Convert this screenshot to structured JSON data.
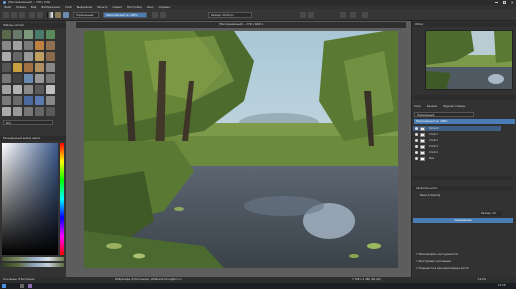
{
  "window": {
    "title": "[Несохранённый] — СНС | Krita"
  },
  "menu": [
    "Файл",
    "Правка",
    "Вид",
    "Изображение",
    "Слой",
    "Выделение",
    "Фильтр",
    "Сервис",
    "Настройка",
    "Окно",
    "Справка"
  ],
  "toolbar": {
    "blend_mode": "Нормальный",
    "opacity_label": "Непрозрачность: 100%",
    "size_label": "Размер: 20.00 px"
  },
  "left_dock": {
    "brushes_title": "Наборы кистей",
    "color_title": "Расширенный выбор цвета",
    "tag_label": "Всё"
  },
  "document_tab": "[Несохранённый] — СНС | RAW 1",
  "right_dock": {
    "overview_title": "Обзор",
    "tabs": [
      "Слои",
      "Каналы",
      "Журнал отмены"
    ],
    "layer_mode": "Нормальный",
    "layer_opacity": "Непрозрачность: 100%",
    "layers": [
      "Фильтр",
      "Слой 1",
      "Слой 2",
      "Слой 3",
      "Слой 4",
      "Фон"
    ],
    "brush_props_title": "Свойства кисти",
    "brush_name": "Basic-2 Opacity",
    "brush_size": "Размер: 20",
    "mix_label": "Смешивание",
    "checkbox_labels": [
      "Маскировать инструментом",
      "Инструмент рисования",
      "Перенести в альтернативные кисти"
    ]
  },
  "status": {
    "left": "Основные: 8 бит/канал",
    "center": "RGB/альфа (8 бит/канал), sRGB-elle-V2-srgbtrc.icc",
    "right": "3 768 x 2 480 (96 dpi)",
    "zoom": "16.6%"
  },
  "taskbar": {
    "clock": "15:28"
  },
  "colors": {
    "accent": "#4a7db5",
    "selected_layer": "#3f5f86"
  }
}
